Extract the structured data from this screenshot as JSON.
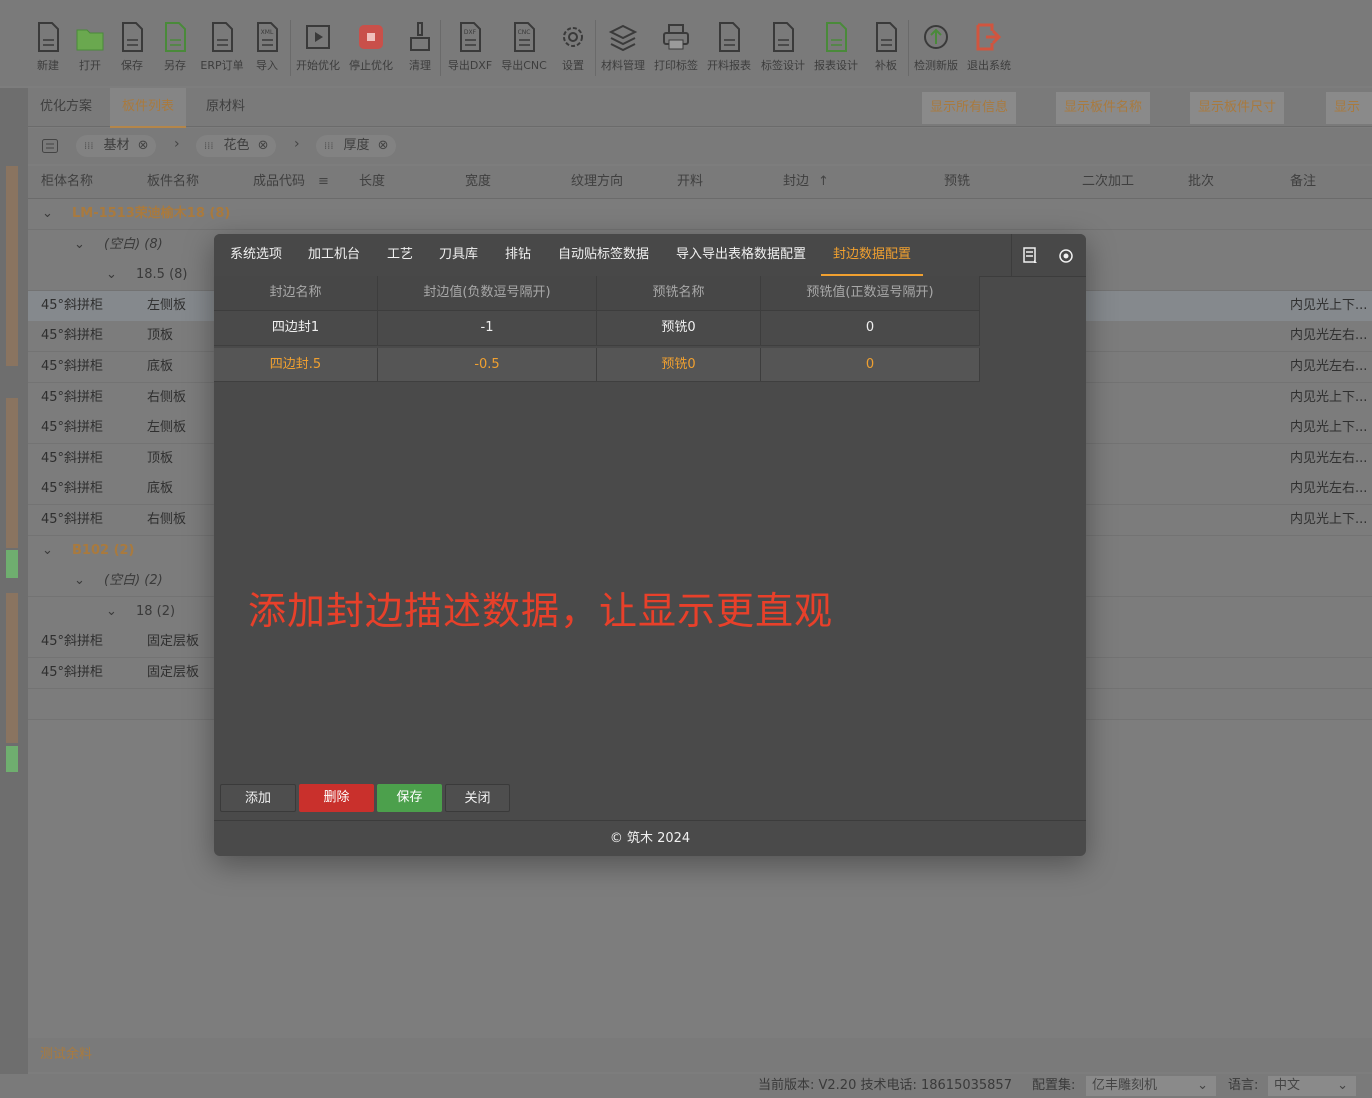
{
  "toolbar": {
    "items": [
      {
        "label": "新建",
        "icon": "new-file-icon"
      },
      {
        "label": "打开",
        "icon": "folder-open-icon"
      },
      {
        "label": "保存",
        "icon": "save-icon"
      },
      {
        "label": "另存",
        "icon": "save-as-icon"
      },
      {
        "label": "ERP订单",
        "icon": "erp-order-icon"
      },
      {
        "label": "导入",
        "icon": "xml-import-icon"
      },
      {
        "label": "开始优化",
        "icon": "play-icon"
      },
      {
        "label": "停止优化",
        "icon": "stop-icon"
      },
      {
        "label": "清理",
        "icon": "brush-icon"
      },
      {
        "label": "导出DXF",
        "icon": "dxf-export-icon"
      },
      {
        "label": "导出CNC",
        "icon": "cnc-export-icon"
      },
      {
        "label": "设置",
        "icon": "gear-icon"
      },
      {
        "label": "材料管理",
        "icon": "layers-icon"
      },
      {
        "label": "打印标签",
        "icon": "printer-icon"
      },
      {
        "label": "开料报表",
        "icon": "cut-report-icon"
      },
      {
        "label": "标签设计",
        "icon": "barcode-icon"
      },
      {
        "label": "报表设计",
        "icon": "report-design-icon"
      },
      {
        "label": "补板",
        "icon": "patch-board-icon"
      },
      {
        "label": "检测新版",
        "icon": "update-icon"
      },
      {
        "label": "退出系统",
        "icon": "exit-icon"
      }
    ]
  },
  "tabs": {
    "items": [
      "优化方案",
      "板件列表",
      "原材料"
    ],
    "active": 1
  },
  "show_buttons": [
    "显示所有信息",
    "显示板件名称",
    "显示板件尺寸",
    "显示开"
  ],
  "filters": {
    "chips": [
      "基材",
      "花色",
      "厚度"
    ]
  },
  "table": {
    "headers": [
      "柜体名称",
      "板件名称",
      "成品代码",
      "长度",
      "宽度",
      "纹理方向",
      "开料",
      "封边",
      "预铣",
      "二次加工",
      "批次",
      "备注"
    ],
    "rows": [
      {
        "kind": "group",
        "level": 0,
        "label": "LM-1513荣迪榆木18 (8)"
      },
      {
        "kind": "sub",
        "level": 1,
        "label": "(空白) (8)"
      },
      {
        "kind": "sub",
        "level": 2,
        "label": "18.5 (8)"
      },
      {
        "kind": "data",
        "cabinet": "45°斜拼柜",
        "board": "左侧板",
        "note": "内见光上下...",
        "hl": true
      },
      {
        "kind": "data",
        "cabinet": "45°斜拼柜",
        "board": "顶板",
        "note": "内见光左右..."
      },
      {
        "kind": "data",
        "cabinet": "45°斜拼柜",
        "board": "底板",
        "note": "内见光左右..."
      },
      {
        "kind": "data",
        "cabinet": "45°斜拼柜",
        "board": "右侧板",
        "note": "内见光上下..."
      },
      {
        "kind": "data",
        "cabinet": "45°斜拼柜",
        "board": "左侧板",
        "note": "内见光上下..."
      },
      {
        "kind": "data",
        "cabinet": "45°斜拼柜",
        "board": "顶板",
        "note": "内见光左右..."
      },
      {
        "kind": "data",
        "cabinet": "45°斜拼柜",
        "board": "底板",
        "note": "内见光左右..."
      },
      {
        "kind": "data",
        "cabinet": "45°斜拼柜",
        "board": "右侧板",
        "note": "内见光上下..."
      },
      {
        "kind": "group",
        "level": 0,
        "label": "B102 (2)"
      },
      {
        "kind": "sub",
        "level": 1,
        "label": "(空白) (2)"
      },
      {
        "kind": "sub",
        "level": 2,
        "label": "18 (2)"
      },
      {
        "kind": "data",
        "cabinet": "45°斜拼柜",
        "board": "固定层板",
        "note": ""
      },
      {
        "kind": "data",
        "cabinet": "45°斜拼柜",
        "board": "固定层板",
        "note": ""
      }
    ]
  },
  "bottom": {
    "label": "测试余料"
  },
  "status": {
    "version": "当前版本: V2.20 技术电话: 18615035857",
    "config_label": "配置集:",
    "config_value": "亿丰雕刻机",
    "lang_label": "语言:",
    "lang_value": "中文"
  },
  "dialog": {
    "tabs": [
      "系统选项",
      "加工机台",
      "工艺",
      "刀具库",
      "排钻",
      "自动贴标签数据",
      "导入导出表格数据配置",
      "封边数据配置"
    ],
    "active_tab": 7,
    "columns": [
      "封边名称",
      "封边值(负数逗号隔开)",
      "预铣名称",
      "预铣值(正数逗号隔开)"
    ],
    "rows": [
      {
        "name": "四边封1",
        "value": "-1",
        "mill_name": "预铣0",
        "mill_value": "0"
      },
      {
        "name": "四边封.5",
        "value": "-0.5",
        "mill_name": "预铣0",
        "mill_value": "0",
        "selected": true
      }
    ],
    "notice": "添加封边描述数据，让显示更直观",
    "buttons": {
      "add": "添加",
      "delete": "删除",
      "save": "保存",
      "close": "关闭"
    },
    "footer": "© 筑木 2024"
  },
  "colors": {
    "accent": "#f0a030",
    "danger": "#c9302c",
    "success": "#4ca04c",
    "notice": "#e8402a"
  }
}
